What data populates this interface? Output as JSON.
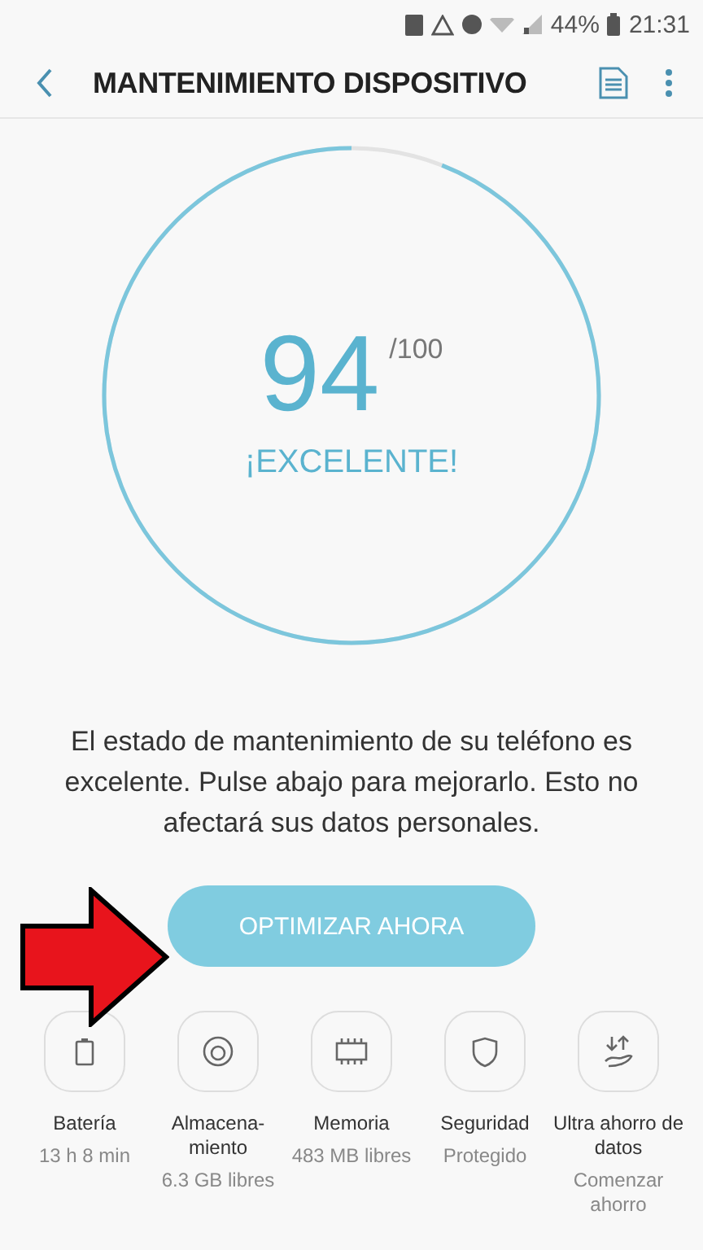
{
  "status_bar": {
    "battery": "44%",
    "time": "21:31"
  },
  "header": {
    "title": "MANTENIMIENTO DISPOSITIVO"
  },
  "score": {
    "value": "94",
    "max": "/100",
    "rating": "¡EXCELENTE!",
    "level": 0.94
  },
  "message": "El estado de mantenimiento de su teléfono es excelente. Pulse abajo para mejorarlo. Esto no afectará sus datos personales.",
  "optimize_button": "OPTIMIZAR AHORA",
  "tools": [
    {
      "kind": "battery",
      "label": "Batería",
      "detail": "13 h 8 min"
    },
    {
      "kind": "storage",
      "label": "Almacena-\nmiento",
      "detail": "6.3 GB libres"
    },
    {
      "kind": "memory",
      "label": "Memoria",
      "detail": "483 MB libres"
    },
    {
      "kind": "security",
      "label": "Seguridad",
      "detail": "Protegido"
    },
    {
      "kind": "data_saver",
      "label": "Ultra ahorro de datos",
      "detail": "Comenzar ahorro"
    }
  ]
}
